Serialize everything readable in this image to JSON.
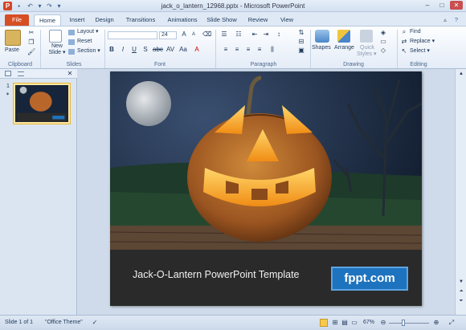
{
  "window": {
    "title": "jack_o_lantern_12968.pptx - Microsoft PowerPoint"
  },
  "tabs": [
    "File",
    "Home",
    "Insert",
    "Design",
    "Transitions",
    "Animations",
    "Slide Show",
    "Review",
    "View"
  ],
  "ribbon": {
    "clipboard": {
      "paste": "Paste",
      "label": "Clipboard"
    },
    "slides": {
      "new_slide_1": "New",
      "new_slide_2": "Slide ▾",
      "layout": "Layout ▾",
      "reset": "Reset",
      "section": "Section ▾",
      "label": "Slides"
    },
    "font": {
      "size": "24",
      "label": "Font"
    },
    "paragraph": {
      "label": "Paragraph"
    },
    "drawing": {
      "shapes": "Shapes",
      "arrange": "Arrange",
      "quick_1": "Quick",
      "quick_2": "Styles ▾",
      "label": "Drawing"
    },
    "editing": {
      "find": "Find",
      "replace": "Replace ▾",
      "select": "Select ▾",
      "label": "Editing"
    }
  },
  "left_pane": {
    "slide_number": "1"
  },
  "slide": {
    "title": "Jack-O-Lantern PowerPoint Template",
    "logo": "fppt.com"
  },
  "status": {
    "slide": "Slide 1 of 1",
    "theme": "\"Office Theme\"",
    "zoom": "67%"
  },
  "colors": {
    "file_tab": "#d64e23",
    "slide_bar": "#2a2a2a",
    "logo_bg": "#1e73be",
    "pumpkin": "#c47a2c"
  }
}
